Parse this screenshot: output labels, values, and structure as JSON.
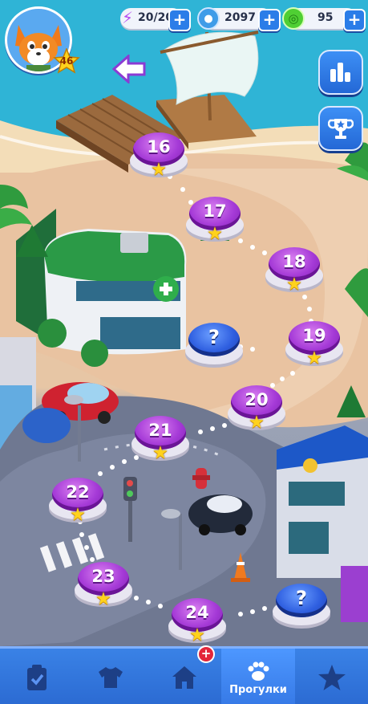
{
  "hud": {
    "player_level": "46",
    "energy": "20/20",
    "coins": "2097",
    "candies": "95"
  },
  "levels": {
    "l16": "16",
    "l17": "17",
    "l18": "18",
    "l19": "19",
    "l20": "20",
    "l21": "21",
    "l22": "22",
    "l23": "23",
    "l24": "24",
    "mystery_a": "?",
    "mystery_b": "?"
  },
  "nav": {
    "tab_walks_label": "Прогулки",
    "home_badge": "+"
  },
  "icons": {
    "avatar": "fox-avatar-icon",
    "energy": "lightning-icon",
    "coins": "coin-icon",
    "candies": "candy-icon",
    "back": "arrow-left-icon",
    "stats": "bar-chart-icon",
    "trophy": "trophy-icon",
    "tasks": "clipboard-check-icon",
    "wardrobe": "tshirt-icon",
    "home": "home-icon",
    "walks": "paw-icon",
    "favorites": "star-icon"
  },
  "colors": {
    "level_node": "#a53ad7",
    "mystery_node": "#2f5fe0",
    "nav_bar": "#2b6ad2",
    "star": "#ffd21c"
  }
}
